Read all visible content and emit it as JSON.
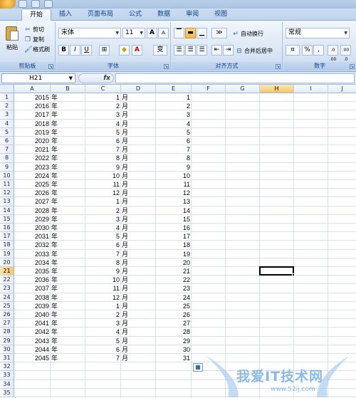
{
  "tabs": [
    "开始",
    "插入",
    "页面布局",
    "公式",
    "数据",
    "审阅",
    "视图"
  ],
  "active_tab": "开始",
  "clipboard": {
    "paste_label": "粘贴",
    "cut_label": "剪切",
    "copy_label": "复制",
    "format_painter_label": "格式刷",
    "group_label": "剪贴板"
  },
  "font": {
    "font_name": "宋体",
    "font_size": "11",
    "bold": "B",
    "italic": "I",
    "underline": "U",
    "grow": "A",
    "shrink": "A",
    "phonetic": "变",
    "font_color_letter": "A",
    "group_label": "字体"
  },
  "alignment": {
    "wrap_text_label": "自动换行",
    "merge_center_label": "合并后居中",
    "group_label": "对齐方式"
  },
  "number": {
    "format_value": "常规",
    "percent": "%",
    "comma": ",",
    "inc_decimal": ".0 .00",
    "dec_decimal": ".00 .0",
    "group_label": "数字"
  },
  "formula_bar": {
    "name_box": "H21",
    "fx_label": "fx",
    "formula": ""
  },
  "columns": [
    "A",
    "B",
    "C",
    "D",
    "E",
    "F",
    "G",
    "H",
    "I",
    "J"
  ],
  "selected_column": "H",
  "selected_row": 21,
  "rows": [
    {
      "n": "1",
      "a": "2015",
      "b": "年",
      "c": "1",
      "d": "月",
      "e": "1"
    },
    {
      "n": "2",
      "a": "2016",
      "b": "年",
      "c": "2",
      "d": "月",
      "e": "2"
    },
    {
      "n": "3",
      "a": "2017",
      "b": "年",
      "c": "3",
      "d": "月",
      "e": "3"
    },
    {
      "n": "4",
      "a": "2018",
      "b": "年",
      "c": "4",
      "d": "月",
      "e": "4"
    },
    {
      "n": "5",
      "a": "2019",
      "b": "年",
      "c": "5",
      "d": "月",
      "e": "5"
    },
    {
      "n": "6",
      "a": "2020",
      "b": "年",
      "c": "6",
      "d": "月",
      "e": "6"
    },
    {
      "n": "7",
      "a": "2021",
      "b": "年",
      "c": "7",
      "d": "月",
      "e": "7"
    },
    {
      "n": "8",
      "a": "2022",
      "b": "年",
      "c": "8",
      "d": "月",
      "e": "8"
    },
    {
      "n": "9",
      "a": "2023",
      "b": "年",
      "c": "9",
      "d": "月",
      "e": "9"
    },
    {
      "n": "10",
      "a": "2024",
      "b": "年",
      "c": "10",
      "d": "月",
      "e": "10"
    },
    {
      "n": "11",
      "a": "2025",
      "b": "年",
      "c": "11",
      "d": "月",
      "e": "11"
    },
    {
      "n": "12",
      "a": "2026",
      "b": "年",
      "c": "12",
      "d": "月",
      "e": "12"
    },
    {
      "n": "13",
      "a": "2027",
      "b": "年",
      "c": "1",
      "d": "月",
      "e": "13"
    },
    {
      "n": "14",
      "a": "2028",
      "b": "年",
      "c": "2",
      "d": "月",
      "e": "14"
    },
    {
      "n": "15",
      "a": "2029",
      "b": "年",
      "c": "3",
      "d": "月",
      "e": "15"
    },
    {
      "n": "16",
      "a": "2030",
      "b": "年",
      "c": "4",
      "d": "月",
      "e": "16"
    },
    {
      "n": "17",
      "a": "2031",
      "b": "年",
      "c": "5",
      "d": "月",
      "e": "17"
    },
    {
      "n": "18",
      "a": "2032",
      "b": "年",
      "c": "6",
      "d": "月",
      "e": "18"
    },
    {
      "n": "19",
      "a": "2033",
      "b": "年",
      "c": "7",
      "d": "月",
      "e": "19"
    },
    {
      "n": "20",
      "a": "2034",
      "b": "年",
      "c": "8",
      "d": "月",
      "e": "20"
    },
    {
      "n": "21",
      "a": "2035",
      "b": "年",
      "c": "9",
      "d": "月",
      "e": "21"
    },
    {
      "n": "22",
      "a": "2036",
      "b": "年",
      "c": "10",
      "d": "月",
      "e": "22"
    },
    {
      "n": "23",
      "a": "2037",
      "b": "年",
      "c": "11",
      "d": "月",
      "e": "23"
    },
    {
      "n": "24",
      "a": "2038",
      "b": "年",
      "c": "12",
      "d": "月",
      "e": "24"
    },
    {
      "n": "25",
      "a": "2039",
      "b": "年",
      "c": "1",
      "d": "月",
      "e": "25"
    },
    {
      "n": "26",
      "a": "2040",
      "b": "年",
      "c": "2",
      "d": "月",
      "e": "26"
    },
    {
      "n": "27",
      "a": "2041",
      "b": "年",
      "c": "3",
      "d": "月",
      "e": "27"
    },
    {
      "n": "28",
      "a": "2042",
      "b": "年",
      "c": "4",
      "d": "月",
      "e": "28"
    },
    {
      "n": "29",
      "a": "2043",
      "b": "年",
      "c": "5",
      "d": "月",
      "e": "29"
    },
    {
      "n": "30",
      "a": "2044",
      "b": "年",
      "c": "6",
      "d": "月",
      "e": "30"
    },
    {
      "n": "31",
      "a": "2045",
      "b": "年",
      "c": "7",
      "d": "月",
      "e": "31"
    },
    {
      "n": "32",
      "a": "",
      "b": "",
      "c": "",
      "d": "",
      "e": ""
    },
    {
      "n": "33",
      "a": "",
      "b": "",
      "c": "",
      "d": "",
      "e": ""
    },
    {
      "n": "34",
      "a": "",
      "b": "",
      "c": "",
      "d": "",
      "e": ""
    },
    {
      "n": "35",
      "a": "",
      "b": "",
      "c": "",
      "d": "",
      "e": ""
    }
  ],
  "watermark": {
    "text": "我爱IT技术网",
    "url": "www.52ij.com"
  }
}
